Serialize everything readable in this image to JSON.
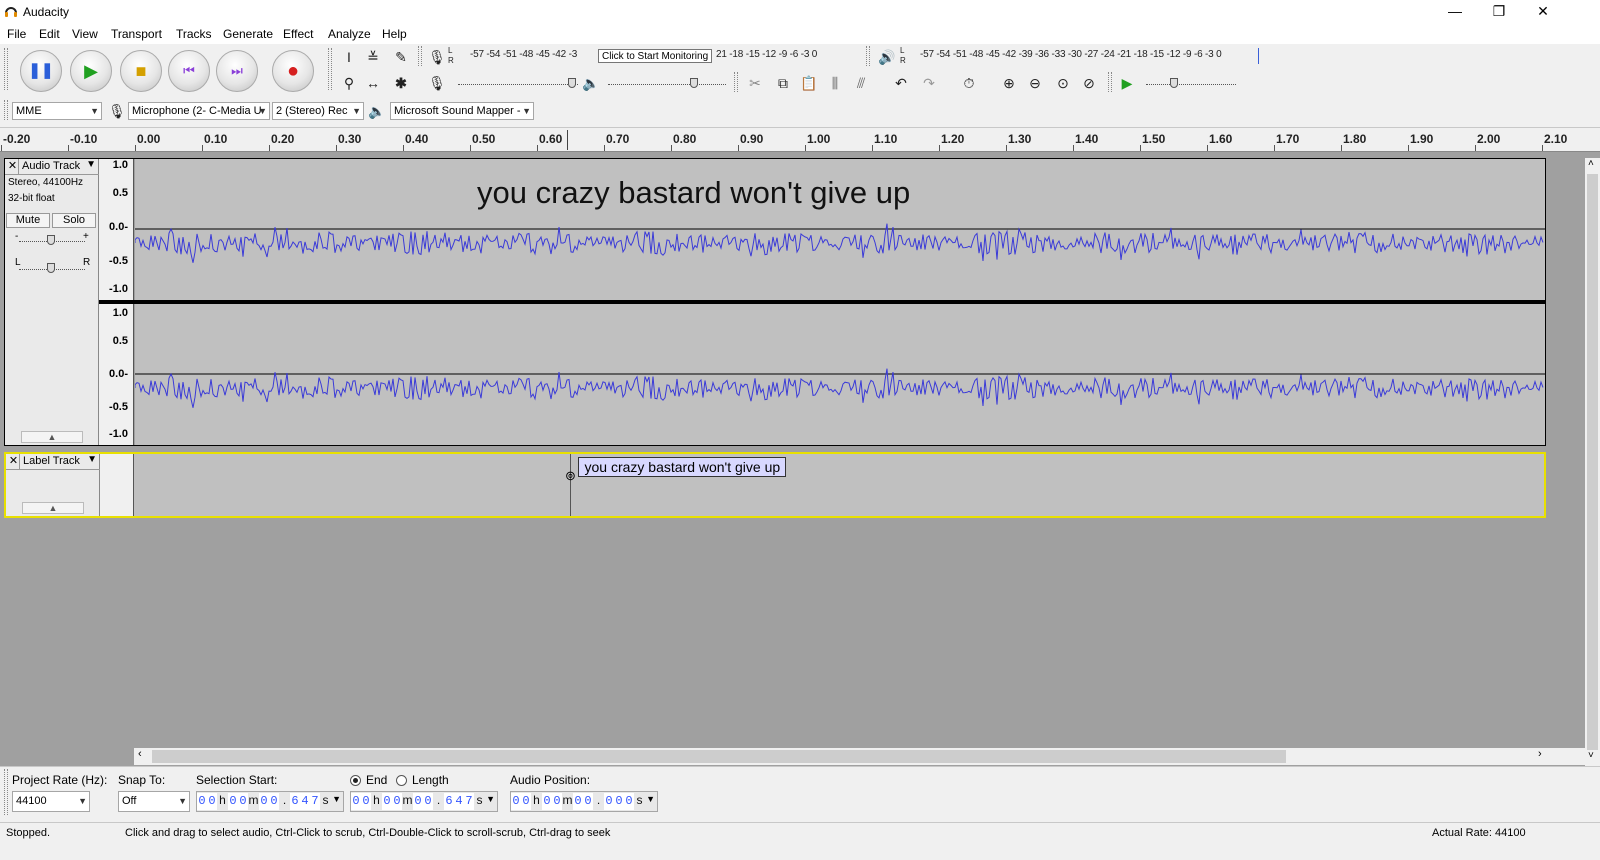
{
  "window": {
    "title": "Audacity",
    "minimize": "—",
    "restore": "❐",
    "close": "✕"
  },
  "menu": [
    "File",
    "Edit",
    "View",
    "Transport",
    "Tracks",
    "Generate",
    "Effect",
    "Analyze",
    "Help"
  ],
  "meters": {
    "record_scale": "-57 -54 -51 -48 -45 -42 -3",
    "record_scale_tail": "21 -18 -15 -12 -9 -6 -3 0",
    "tooltip": "Click to Start Monitoring",
    "play_scale": "-57 -54 -51 -48 -45 -42 -39 -36 -33 -30 -27 -24 -21 -18 -15 -12 -9 -6 -3 0",
    "L": "L",
    "R": "R"
  },
  "devices": {
    "host": "MME",
    "recording_device": "Microphone (2- C-Media U",
    "channels": "2 (Stereo) Rec",
    "playback_device": "Microsoft Sound Mapper -"
  },
  "ruler": {
    "ticks": [
      "-0.20",
      "-0.10",
      "0.00",
      "0.10",
      "0.20",
      "0.30",
      "0.40",
      "0.50",
      "0.60",
      "0.70",
      "0.80",
      "0.90",
      "1.00",
      "1.10",
      "1.20",
      "1.30",
      "1.40",
      "1.50",
      "1.60",
      "1.70",
      "1.80",
      "1.90",
      "2.00",
      "2.10"
    ]
  },
  "audio_track": {
    "close": "✕",
    "name": "Audio Track",
    "format": "Stereo, 44100Hz",
    "bit_depth": "32-bit float",
    "mute": "Mute",
    "solo": "Solo",
    "gain_minus": "-",
    "gain_plus": "+",
    "pan_left": "L",
    "pan_right": "R",
    "scale": [
      "1.0",
      "0.5",
      "0.0-",
      "-0.5",
      "-1.0"
    ],
    "overlay_text": "you crazy bastard won't give up",
    "wave_color": "#3a3ad8"
  },
  "label_track": {
    "close": "✕",
    "name": "Label Track",
    "label_text": "you crazy bastard won't give up",
    "label_time": 0.647
  },
  "selection": {
    "project_rate_label": "Project Rate (Hz):",
    "project_rate": "44100",
    "snap_label": "Snap To:",
    "snap_value": "Off",
    "start_label": "Selection Start:",
    "end_label": "End",
    "length_label": "Length",
    "audio_position_label": "Audio Position:",
    "start_value": [
      "0",
      "0",
      "h",
      "0",
      "0",
      "m",
      "0",
      "0",
      ".",
      "6",
      "4",
      "7",
      "s"
    ],
    "end_value": [
      "0",
      "0",
      "h",
      "0",
      "0",
      "m",
      "0",
      "0",
      ".",
      "6",
      "4",
      "7",
      "s"
    ],
    "position_value": [
      "0",
      "0",
      "h",
      "0",
      "0",
      "m",
      "0",
      "0",
      ".",
      "0",
      "0",
      "0",
      "s"
    ]
  },
  "status": {
    "state": "Stopped.",
    "hint": "Click and drag to select audio, Ctrl-Click to scrub, Ctrl-Double-Click to scroll-scrub, Ctrl-drag to seek",
    "actual_rate": "Actual Rate: 44100"
  }
}
